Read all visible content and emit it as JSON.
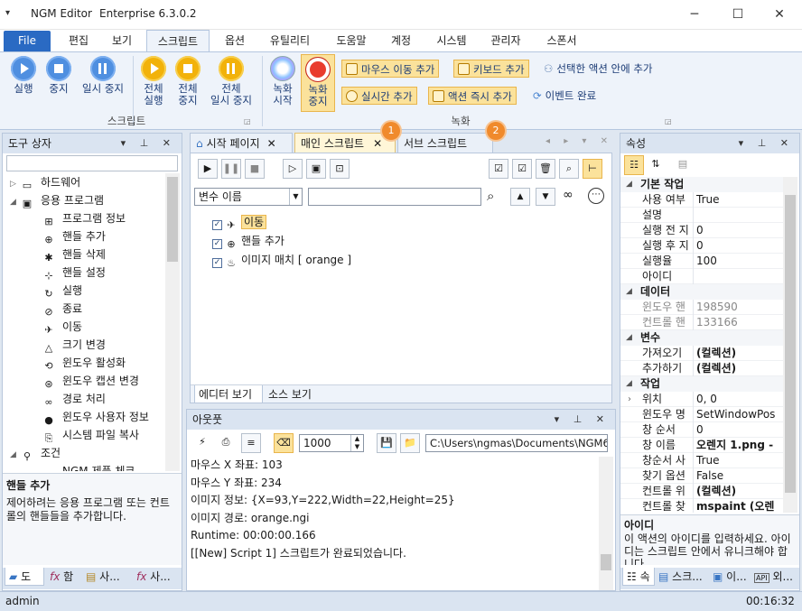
{
  "window": {
    "app_name": "NGM Editor",
    "edition": "Enterprise 6.3.0.2",
    "controls": {
      "minimize": "─",
      "maximize": "☐",
      "close": "✕"
    }
  },
  "menu": {
    "file": "File",
    "items": [
      "편집",
      "보기",
      "스크립트",
      "옵션",
      "유틸리티",
      "도움말",
      "계정",
      "시스템",
      "관리자",
      "스폰서"
    ],
    "active_index": 2
  },
  "ribbon": {
    "script_group": {
      "label": "스크립트",
      "buttons": [
        {
          "line1": "실행",
          "line2": ""
        },
        {
          "line1": "중지",
          "line2": ""
        },
        {
          "line1": "일시 중지",
          "line2": ""
        },
        {
          "line1": "전체",
          "line2": "실행"
        },
        {
          "line1": "전체",
          "line2": "중지"
        },
        {
          "line1": "전체",
          "line2": "일시 중지"
        }
      ]
    },
    "record_group": {
      "label": "녹화",
      "record_start": {
        "line1": "녹화",
        "line2": "시작"
      },
      "record_stop": {
        "line1": "녹화",
        "line2": "중지"
      },
      "mouse_move_add": "마우스 이동 추가",
      "keyboard_add": "키보드 추가",
      "add_in_selected": "선택한 액션 안에 추가",
      "realtime_add": "실시간 추가",
      "action_immediate_add": "액션 즉시 추가",
      "event_complete": "이벤트 완료"
    }
  },
  "toolbox": {
    "title": "도구 상자",
    "items": [
      {
        "label": "하드웨어",
        "level": 0,
        "toggle": "▷",
        "icon": "computer-icon",
        "glyph": "▭"
      },
      {
        "label": "응용 프로그램",
        "level": 0,
        "toggle": "◢",
        "icon": "console-icon",
        "glyph": "▣"
      },
      {
        "label": "프로그램 정보",
        "level": 1,
        "icon": "program-info-icon",
        "glyph": "⊞"
      },
      {
        "label": "핸들 추가",
        "level": 1,
        "icon": "crosshair-icon",
        "glyph": "⊕"
      },
      {
        "label": "핸들 삭제",
        "level": 1,
        "icon": "handle-delete-icon",
        "glyph": "✱"
      },
      {
        "label": "핸들 설정",
        "level": 1,
        "icon": "handle-set-icon",
        "glyph": "⊹"
      },
      {
        "label": "실행",
        "level": 1,
        "icon": "run-icon",
        "glyph": "↻"
      },
      {
        "label": "종료",
        "level": 1,
        "icon": "exit-icon",
        "glyph": "⊘"
      },
      {
        "label": "이동",
        "level": 1,
        "icon": "move-icon",
        "glyph": "✈"
      },
      {
        "label": "크기 변경",
        "level": 1,
        "icon": "resize-icon",
        "glyph": "△"
      },
      {
        "label": "윈도우 활성화",
        "level": 1,
        "icon": "activate-icon",
        "glyph": "⟲"
      },
      {
        "label": "윈도우 캡션 변경",
        "level": 1,
        "icon": "caption-icon",
        "glyph": "⊛"
      },
      {
        "label": "경로 처리",
        "level": 1,
        "icon": "path-icon",
        "glyph": "∞"
      },
      {
        "label": "윈도우 사용자 정보",
        "level": 1,
        "icon": "user-icon",
        "glyph": "●"
      },
      {
        "label": "시스템 파일 복사",
        "level": 1,
        "icon": "copy-icon",
        "glyph": "⎘"
      },
      {
        "label": "조건",
        "level": 0,
        "toggle": "◢",
        "icon": "condition-icon",
        "glyph": "⚲"
      },
      {
        "label": "NGM 제품 체크",
        "level": 1,
        "icon": "ngm-check-icon",
        "glyph": "▬"
      }
    ],
    "desc_title": "핸들 추가",
    "desc_text": "제어하려는 응용 프로그램 또는 컨트롤의 핸들들을 추가합니다.",
    "bottom_tabs": [
      "도",
      "함",
      "사...",
      "사..."
    ]
  },
  "editor": {
    "tabs": [
      {
        "label": "시작 페이지"
      },
      {
        "label": "매인 스크립트"
      },
      {
        "label": "서브 스크립트"
      }
    ],
    "badges": [
      "1",
      "2"
    ],
    "variable_select": "변수 이름",
    "search_value": "",
    "script_lines": [
      {
        "label": "이동",
        "icon": "move-icon",
        "glyph": "✈",
        "checked": true,
        "selected": true
      },
      {
        "label": "핸들 추가",
        "icon": "crosshair-icon",
        "glyph": "⊕",
        "checked": true,
        "selected": false
      },
      {
        "label": "이미지 매치 [ orange ]",
        "icon": "image-match-icon",
        "glyph": "♨",
        "checked": true,
        "selected": false
      }
    ],
    "view_tabs": [
      "에디터 보기",
      "소스 보기"
    ]
  },
  "output": {
    "title": "아웃풋",
    "count": "1000",
    "path": "C:\\Users\\ngmas\\Documents\\NGM6\\",
    "lines": [
      "마우스 X 좌표: 103",
      "마우스 Y 좌표: 234",
      "이미지 정보: {X=93,Y=222,Width=22,Height=25}",
      "이미지 경로: orange.ngi",
      "Runtime: 00:00:00.166",
      "[[New] Script 1] 스크립트가 완료되었습니다."
    ]
  },
  "properties": {
    "title": "속성",
    "rows": [
      {
        "type": "cat",
        "label": "기본 작업"
      },
      {
        "name": "사용 여부",
        "value": "True"
      },
      {
        "name": "설명",
        "value": ""
      },
      {
        "name": "실행 전 지",
        "value": "0"
      },
      {
        "name": "실행 후 지",
        "value": "0"
      },
      {
        "name": "실행율",
        "value": "100"
      },
      {
        "name": "아이디",
        "value": ""
      },
      {
        "type": "cat",
        "label": "데이터"
      },
      {
        "name": "윈도우 핸",
        "value": "198590",
        "grey": true
      },
      {
        "name": "컨트롤 핸",
        "value": "133166",
        "grey": true
      },
      {
        "type": "cat",
        "label": "변수"
      },
      {
        "name": "가져오기",
        "value": "(컬렉션)",
        "bold": true
      },
      {
        "name": "추가하기",
        "value": "(컬렉션)",
        "bold": true
      },
      {
        "type": "cat",
        "label": "작업"
      },
      {
        "name": "위치",
        "value": "0, 0",
        "expand": true
      },
      {
        "name": "윈도우 명",
        "value": "SetWindowPos"
      },
      {
        "name": "창 순서",
        "value": "0"
      },
      {
        "name": "창 이름",
        "value": "오렌지 1.png -",
        "bold": true
      },
      {
        "name": "창순서 사",
        "value": "True"
      },
      {
        "name": "찾기 옵션",
        "value": "False"
      },
      {
        "name": "컨트롤 위",
        "value": "(컬렉션)",
        "bold": true
      },
      {
        "name": "컨트롤 찾",
        "value": "mspaint (오렌",
        "bold": true
      }
    ],
    "desc_title": "아이디",
    "desc_text": "이 액션의 아이디를 입력하세요. 아이디는 스크립트 안에서 유니크해야 합니다.",
    "bottom_tabs": [
      "속",
      "스크...",
      "이...",
      "외..."
    ]
  },
  "status": {
    "user": "admin",
    "time": "00:16:32"
  }
}
